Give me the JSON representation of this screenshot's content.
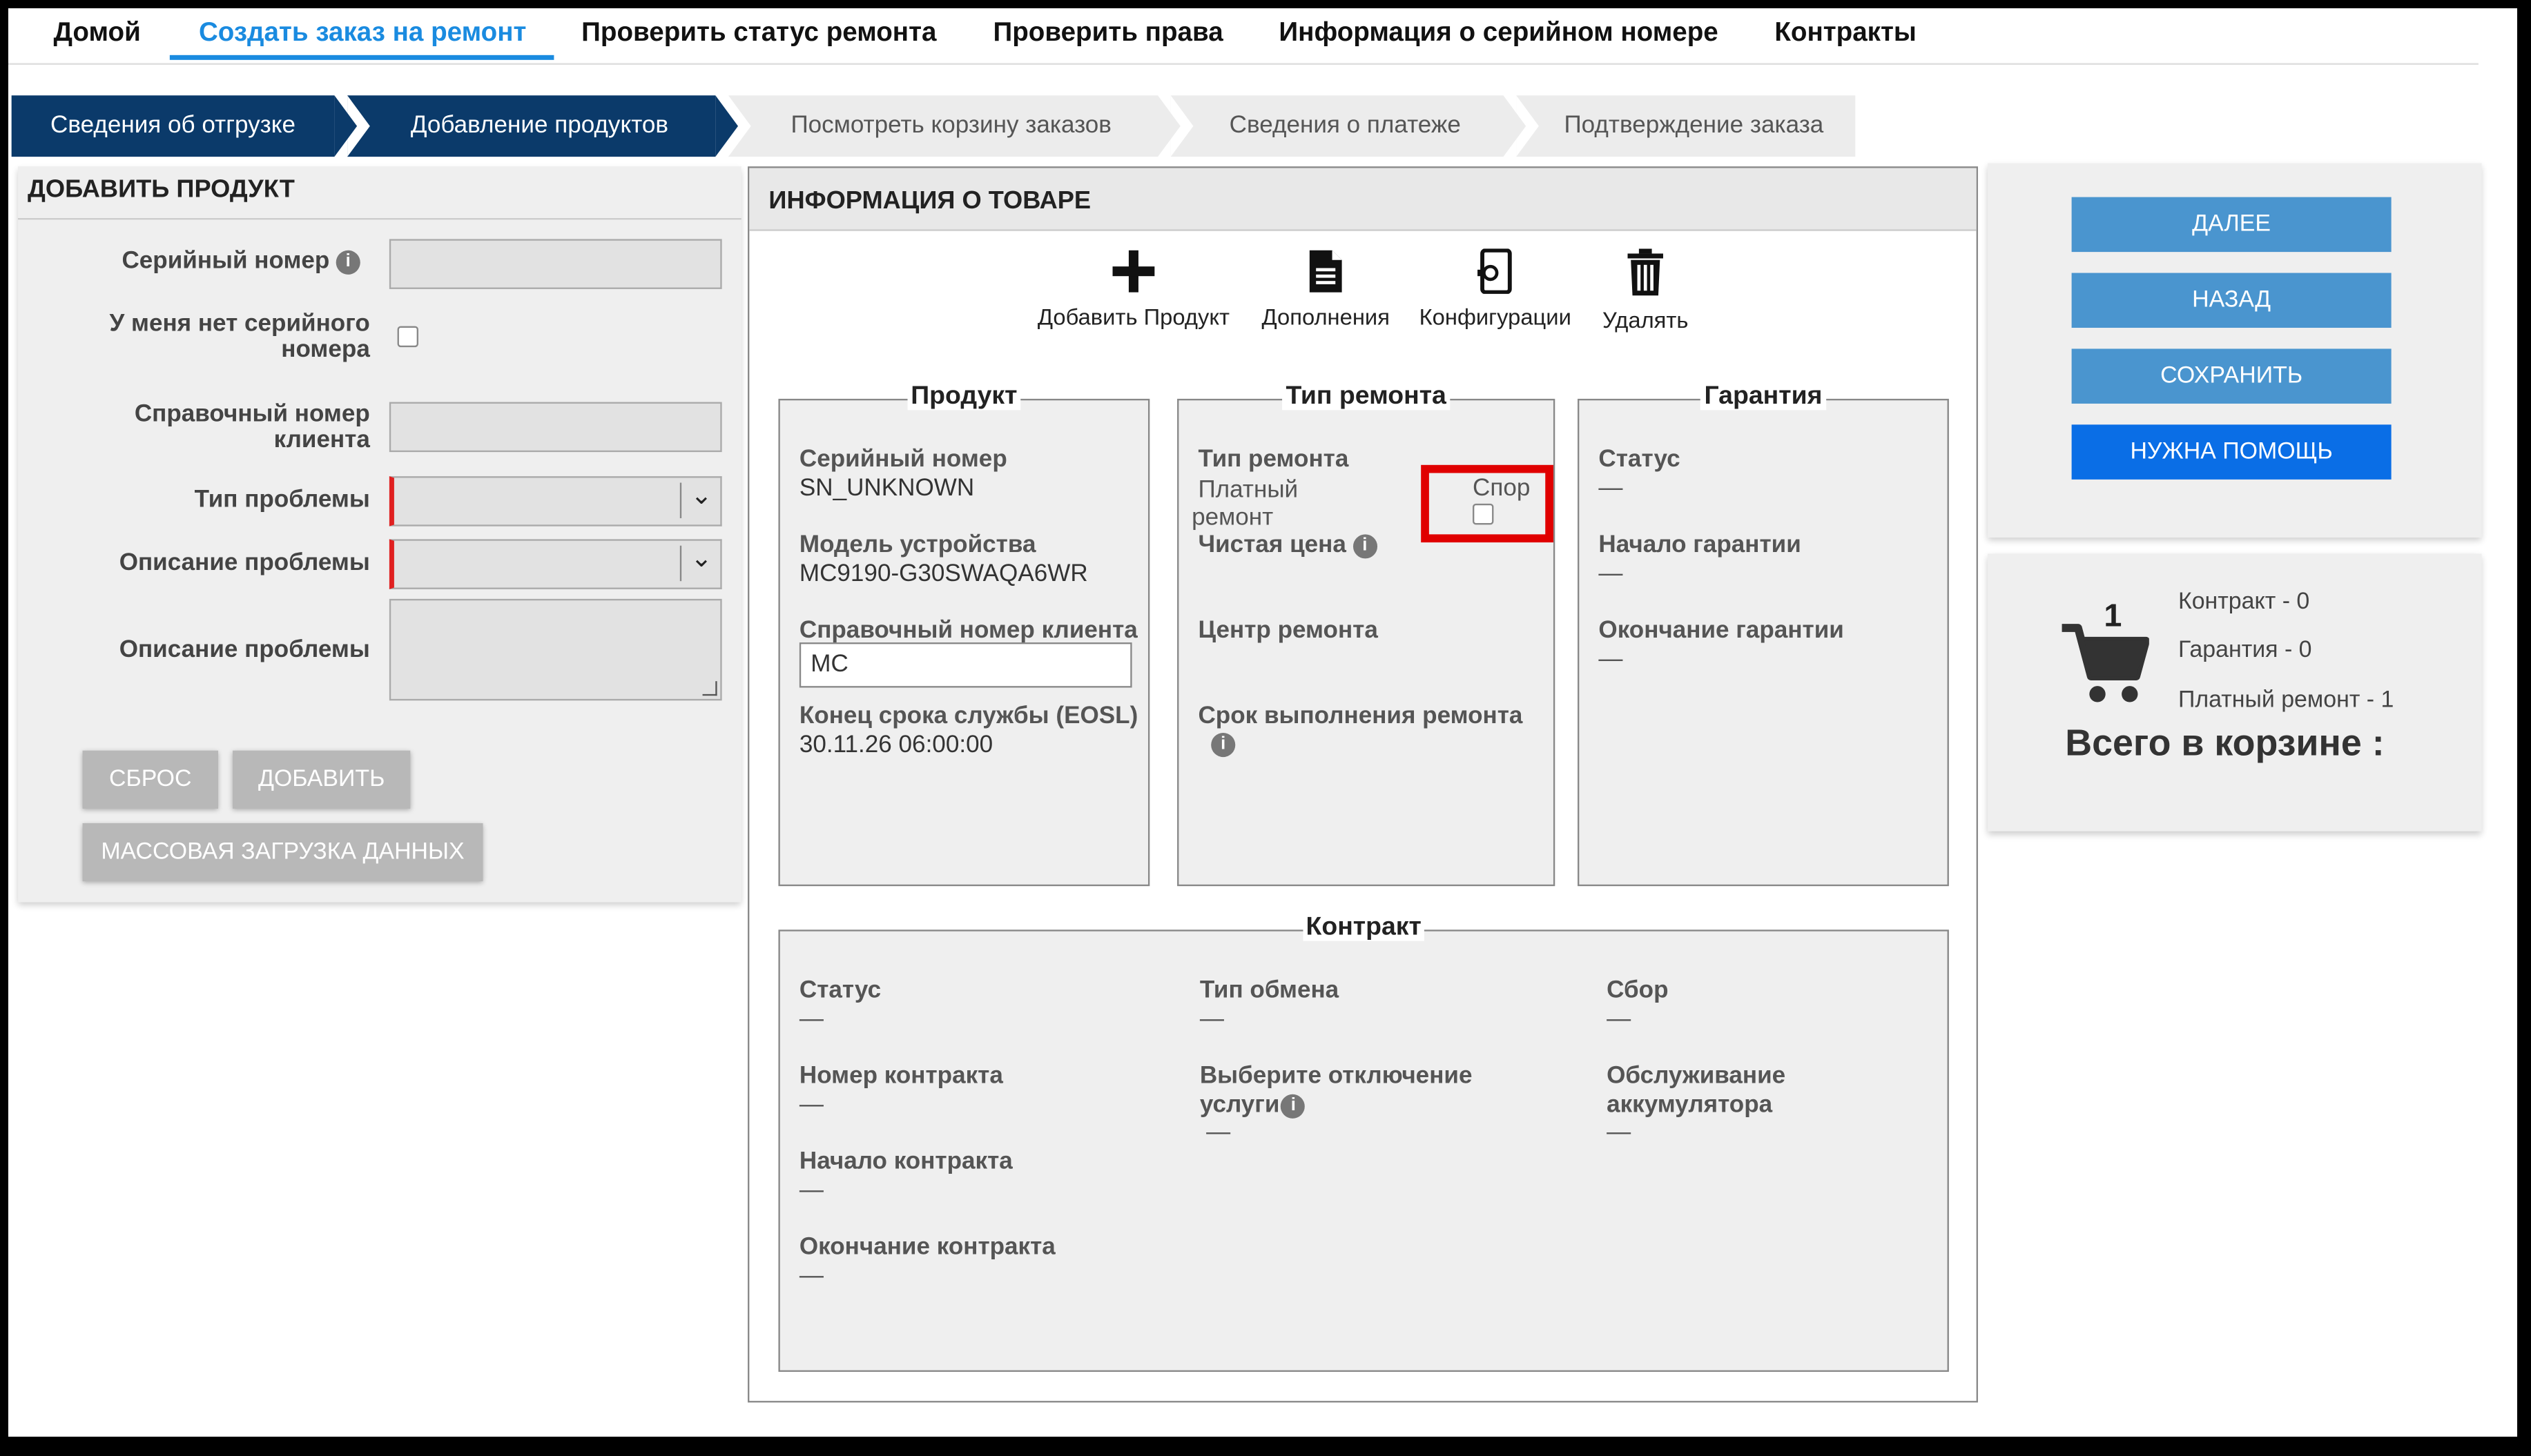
{
  "nav": {
    "items": [
      "Домой",
      "Создать заказ на ремонт",
      "Проверить статус ремонта",
      "Проверить права",
      "Информация о серийном номере",
      "Контракты"
    ]
  },
  "wizard": {
    "steps": [
      "Сведения об отгрузке",
      "Добавление продуктов",
      "Посмотреть корзину заказов",
      "Сведения о платеже",
      "Подтверждение заказа"
    ]
  },
  "add_product": {
    "title": "ДОБАВИТЬ ПРОДУКТ",
    "serial_label": "Серийный номер",
    "no_serial_label_1": "У меня нет серийного",
    "no_serial_label_2": "номера",
    "customer_ref_label_1": "Справочный номер",
    "customer_ref_label_2": "клиента",
    "problem_type_label": "Тип проблемы",
    "problem_desc_label": "Описание проблемы",
    "problem_desc2_label": "Описание проблемы",
    "reset_button": "СБРОС",
    "add_button": "ДОБАВИТЬ",
    "bulk_button": "МАССОВАЯ ЗАГРУЗКА ДАННЫХ"
  },
  "product_info": {
    "title": "ИНФОРМАЦИЯ О ТОВАРЕ",
    "tools": {
      "add": "Добавить Продукт",
      "addons": "Дополнения",
      "config": "Конфигурации",
      "delete": "Удалять"
    },
    "product": {
      "legend": "Продукт",
      "serial_label": "Серийный номер",
      "serial_value": "SN_UNKNOWN",
      "model_label": "Модель устройства",
      "model_value": "MC9190-G30SWAQA6WR",
      "ref_label": "Справочный номер клиента",
      "ref_value": "MC",
      "eosl_label": "Конец срока службы (EOSL)",
      "eosl_value": "30.11.26 06:00:00"
    },
    "repair": {
      "legend": "Тип ремонта",
      "type_label": "Тип ремонта",
      "type_value_1": "Платный",
      "type_value_2": "ремонт",
      "dispute_label": "Спор",
      "net_price_label": "Чистая цена",
      "center_label": "Центр ремонта",
      "turnaround_label": "Срок выполнения ремонта"
    },
    "warranty": {
      "legend": "Гарантия",
      "status_label": "Статус",
      "status_value": "—",
      "start_label": "Начало гарантии",
      "start_value": "—",
      "end_label": "Окончание гарантии",
      "end_value": "—"
    },
    "contract": {
      "legend": "Контракт",
      "status_label": "Статус",
      "status_value": "—",
      "number_label": "Номер контракта",
      "number_value": "—",
      "start_label": "Начало контракта",
      "start_value": "—",
      "end_label": "Окончание контракта",
      "end_value": "—",
      "exchange_label": "Тип обмена",
      "exchange_value": "—",
      "opt_out_label_1": "Выберите отключение",
      "opt_out_label_2": "услуги",
      "opt_out_value": "—",
      "fee_label": "Сбор",
      "fee_value": "—",
      "battery_label_1": "Обслуживание",
      "battery_label_2": "аккумулятора",
      "battery_value": "—"
    }
  },
  "actions": {
    "next": "ДАЛЕЕ",
    "back": "НАЗАД",
    "save": "СОХРАНИТЬ",
    "help": "НУЖНА ПОМОЩЬ"
  },
  "cart": {
    "count": "1",
    "contract": "Контракт - 0",
    "warranty": "Гарантия - 0",
    "paid": "Платный ремонт - 1",
    "total": "Всего в корзине :"
  },
  "colors": {
    "accent": "#1a8be0",
    "wizard_done": "#0b3a6a",
    "action_button": "#4a95cf",
    "help_button": "#0a6ee6",
    "highlight": "#e00000",
    "required": "#e02020"
  }
}
